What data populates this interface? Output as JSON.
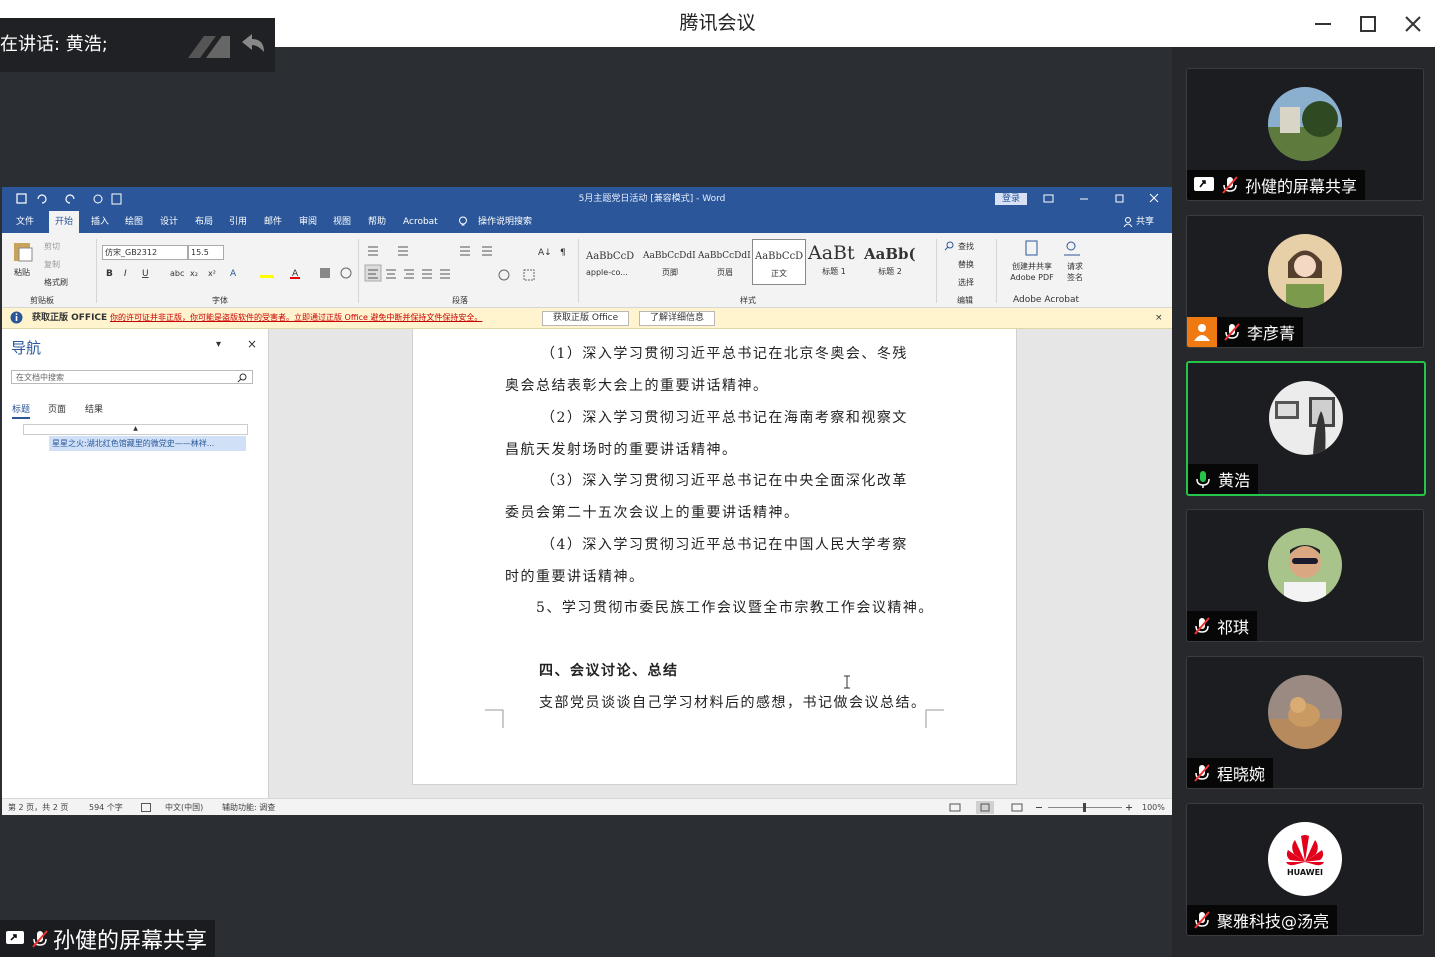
{
  "app": {
    "title": "腾讯会议",
    "speaking": "在讲话: 黄浩;"
  },
  "share_label": "孙健的屏幕共享",
  "participants": [
    {
      "name": "孙健的屏幕共享",
      "mic": "muted",
      "badge": "share"
    },
    {
      "name": "李彦菁",
      "mic": "muted",
      "badge": "person"
    },
    {
      "name": "黄浩",
      "mic": "active",
      "badge": ""
    },
    {
      "name": "祁琪",
      "mic": "muted",
      "badge": ""
    },
    {
      "name": "程晓婉",
      "mic": "muted",
      "badge": ""
    },
    {
      "name": "聚雅科技@汤亮",
      "mic": "muted",
      "badge": ""
    }
  ],
  "word": {
    "title": "5月主题党日活动 [兼容模式] - Word",
    "login": "登录",
    "share": "共享",
    "tabs": [
      "文件",
      "开始",
      "插入",
      "绘图",
      "设计",
      "布局",
      "引用",
      "邮件",
      "审阅",
      "视图",
      "帮助",
      "Acrobat",
      "操作说明搜索"
    ],
    "ribbon": {
      "paste": "粘贴",
      "cut": "剪切",
      "copy": "复制",
      "format_painter": "格式刷",
      "clipboard": "剪贴板",
      "font_name": "仿宋_GB2312",
      "font_size": "15.5",
      "font_group": "字体",
      "paragraph_group": "段落",
      "styles_group": "样式",
      "edit_group": "编辑",
      "acrobat_group": "Adobe Acrobat",
      "find": "查找",
      "replace": "替换",
      "select": "选择",
      "create_pdf": "创建并共享 Adobe PDF",
      "request_sign": "请求 签名",
      "styles": [
        {
          "preview": "AaBbCcD",
          "label": "apple-co..."
        },
        {
          "preview": "AaBbCcDdI",
          "label": "页脚"
        },
        {
          "preview": "AaBbCcDdI",
          "label": "页眉"
        },
        {
          "preview": "AaBbCcD",
          "label": "正文"
        },
        {
          "preview": "AaBt",
          "label": "标题 1"
        },
        {
          "preview": "AaBb(",
          "label": "标题 2"
        }
      ]
    },
    "warning": {
      "title": "获取正版 OFFICE",
      "text": "你的许可证并非正版，你可能是盗版软件的受害者。立即通过正版 Office 避免中断并保持文件保持安全。",
      "btn1": "获取正版 Office",
      "btn2": "了解详细信息"
    },
    "nav": {
      "title": "导航",
      "search_placeholder": "在文档中搜索",
      "tabs": [
        "标题",
        "页面",
        "结果"
      ],
      "item": "星星之火:湖北红色馆藏里的微党史——林祥..."
    },
    "doc_lines": [
      "（1）深入学习贯彻习近平总书记在北京冬奥会、冬残",
      "奥会总结表彰大会上的重要讲话精神。",
      "（2）深入学习贯彻习近平总书记在海南考察和视察文",
      "昌航天发射场时的重要讲话精神。",
      "（3）深入学习贯彻习近平总书记在中央全面深化改革",
      "委员会第二十五次会议上的重要讲话精神。",
      "（4）深入学习贯彻习近平总书记在中国人民大学考察",
      "时的重要讲话精神。",
      "5、学习贯彻市委民族工作会议暨全市宗教工作会议精神。",
      "四、会议讨论、总结",
      "支部党员谈谈自己学习材料后的感想，书记做会议总结。"
    ],
    "status": {
      "page": "第 2 页，共 2 页",
      "words": "594 个字",
      "lang": "中文(中国)",
      "accessibility": "辅助功能: 调查",
      "zoom": "100%"
    }
  }
}
